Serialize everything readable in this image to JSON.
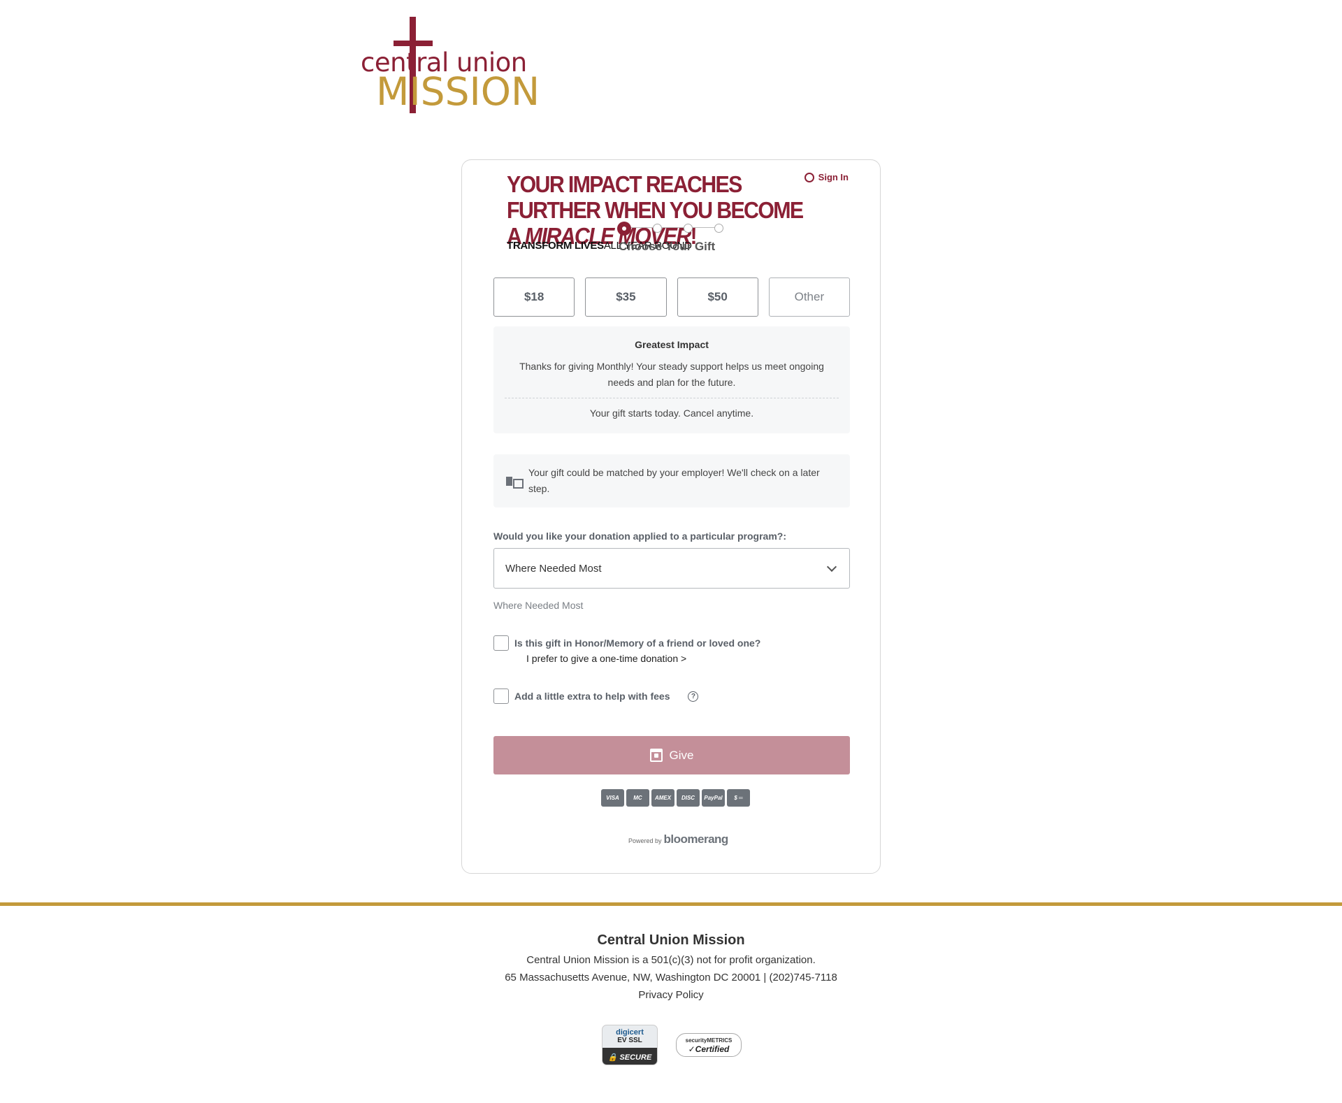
{
  "logo": {
    "line1": "central union",
    "line2": "MISSION"
  },
  "form": {
    "headline_part1": "YOUR IMPACT REACHES FURTHER WHEN YOU BECOME A ",
    "headline_em": "MIRACLE MOVER",
    "headline_part2": "!",
    "sign_in": "Sign In",
    "subhead_bold": "TRANSFORM LIVES",
    "subhead_rest": "ALL YEAR ROUND",
    "step_title": "Choose Your Gift",
    "amounts": [
      "$18",
      "$35",
      "$50"
    ],
    "other_label": "Other",
    "impact": {
      "title": "Greatest Impact",
      "body": "Thanks for giving Monthly! Your steady support helps us meet ongoing needs and plan for the future.",
      "note": "Your gift starts today. Cancel anytime."
    },
    "match_text": "Your gift could be matched by your employer! We'll check on a later step.",
    "program_label": "Would you like your donation applied to a particular program?:",
    "program_value": "Where Needed Most",
    "program_subtext": "Where Needed Most",
    "honor_label": "Is this gift in Honor/Memory of a friend or loved one?",
    "one_time_link": "I prefer to give a one-time donation >",
    "fees_label": "Add a little extra to help with fees",
    "give_label": "Give",
    "payments": [
      "VISA",
      "MC",
      "AMEX",
      "DISC",
      "PayPal",
      "$ ═"
    ],
    "powered_small": "Powered by",
    "powered_brand": "bloomerang"
  },
  "footer": {
    "org": "Central Union Mission",
    "line1": "Central Union Mission is a 501(c)(3) not for profit organization.",
    "line2": "65 Massachusetts Avenue, NW, Washington DC 20001 | (202)745-7118",
    "privacy": "Privacy Policy"
  },
  "badges": {
    "digicert_top": "digicert",
    "digicert_ev": "EV SSL",
    "digicert_bottom": "🔒 SECURE",
    "secmet_top": "securityMETRICS",
    "secmet_bottom": "✓Certified"
  },
  "colors": {
    "brand": "#8b2035",
    "gold": "#c39a3b",
    "give_button": "#c48f99"
  }
}
